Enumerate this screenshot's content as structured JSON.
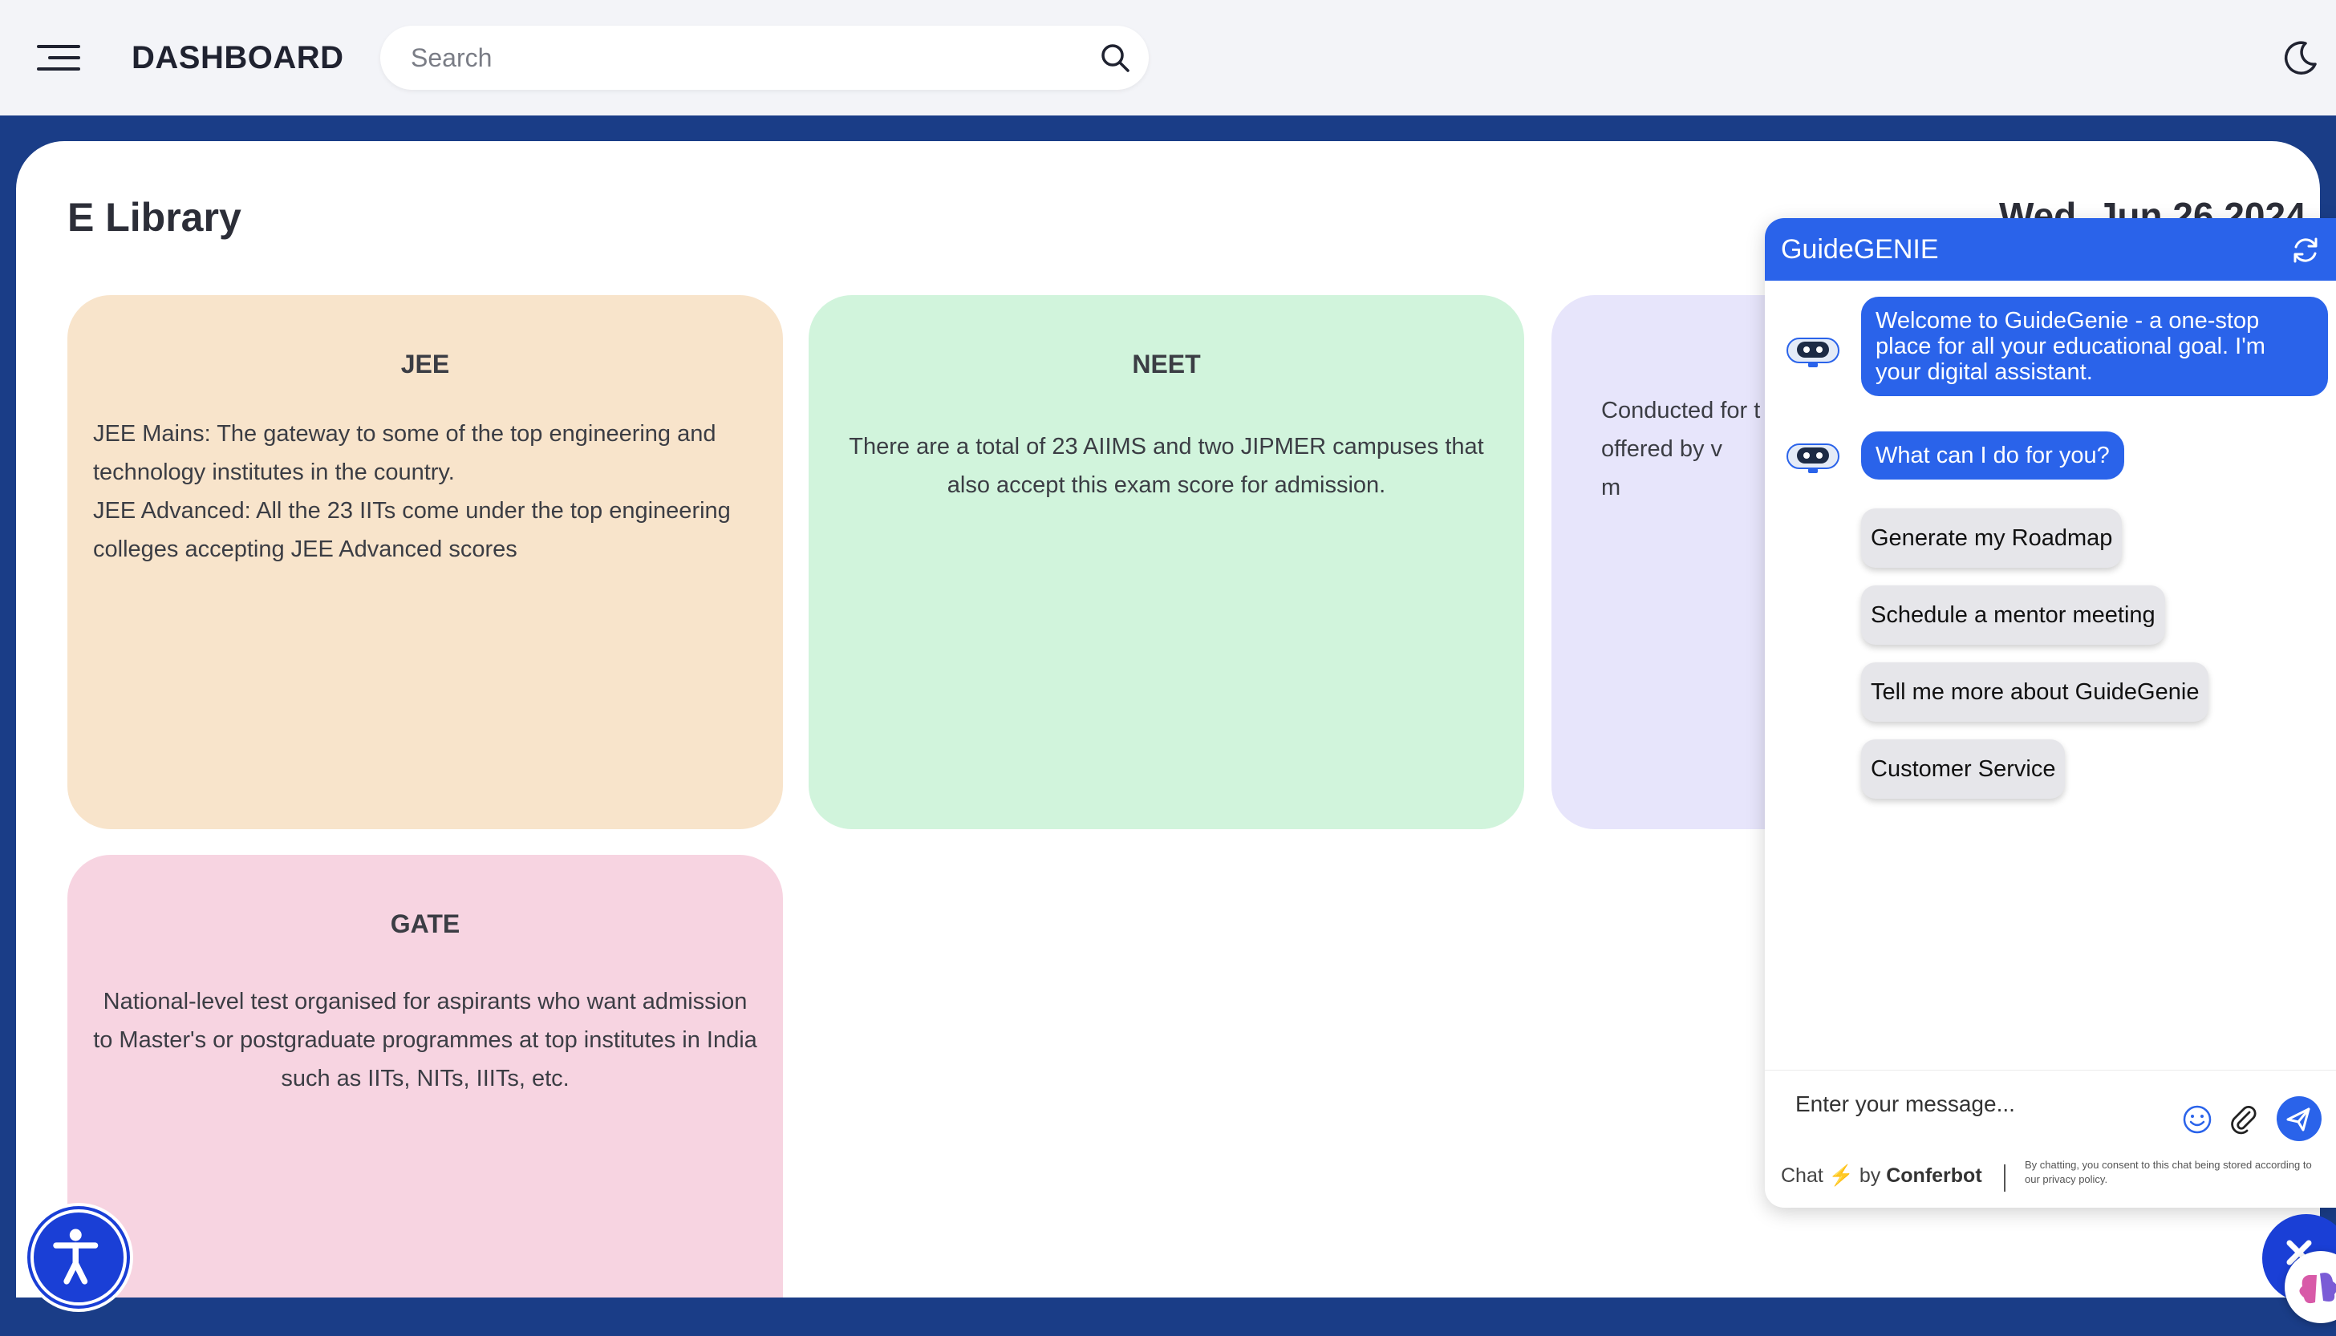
{
  "topbar": {
    "title": "DASHBOARD",
    "search_placeholder": "Search",
    "icons": [
      "menu-icon",
      "search-icon",
      "moon-icon"
    ]
  },
  "main": {
    "page_title": "E Library",
    "date": "Wed, Jun 26 2024",
    "cards": [
      {
        "title": "JEE",
        "paragraphs": [
          "JEE Mains: The gateway to some of the top engineering and technology institutes in the country.",
          "JEE Advanced: All the 23 IITs come under the top engineering colleges accepting JEE Advanced scores"
        ],
        "color": "#f8e4cb"
      },
      {
        "title": "NEET",
        "paragraphs": [
          "There are a total of 23 AIIMS and two JIPMER campuses that also accept this exam score for admission."
        ],
        "color": "#d1f4dc"
      },
      {
        "title": "",
        "paragraphs": [
          "Conducted for t",
          "offered by v",
          "m"
        ],
        "color": "#e7e5fb"
      },
      {
        "title": "GATE",
        "paragraphs": [
          "National-level test organised for aspirants who want admission to Master's or postgraduate programmes at top institutes in India such as IITs, NITs, IIITs, etc."
        ],
        "color": "#f7d4e1"
      }
    ]
  },
  "chat": {
    "title": "GuideGENIE",
    "messages": [
      "Welcome to GuideGenie - a one-stop place for all your educational goal. I'm your digital assistant.",
      "What can I do for you?"
    ],
    "options": [
      "Generate my Roadmap",
      "Schedule a mentor meeting",
      "Tell me more about GuideGenie",
      "Customer Service"
    ],
    "input_placeholder": "Enter your message...",
    "powered_prefix": "Chat",
    "powered_bolt": "⚡",
    "powered_by": "by",
    "powered_brand": "Conferbot",
    "consent": "By chatting, you consent to this chat being stored according to our privacy policy.",
    "accent": "#2a63ea"
  },
  "colors": {
    "page_background": "#1a3d87",
    "topbar": "#f3f4f8",
    "accessibility_button": "#1a3fd6"
  }
}
